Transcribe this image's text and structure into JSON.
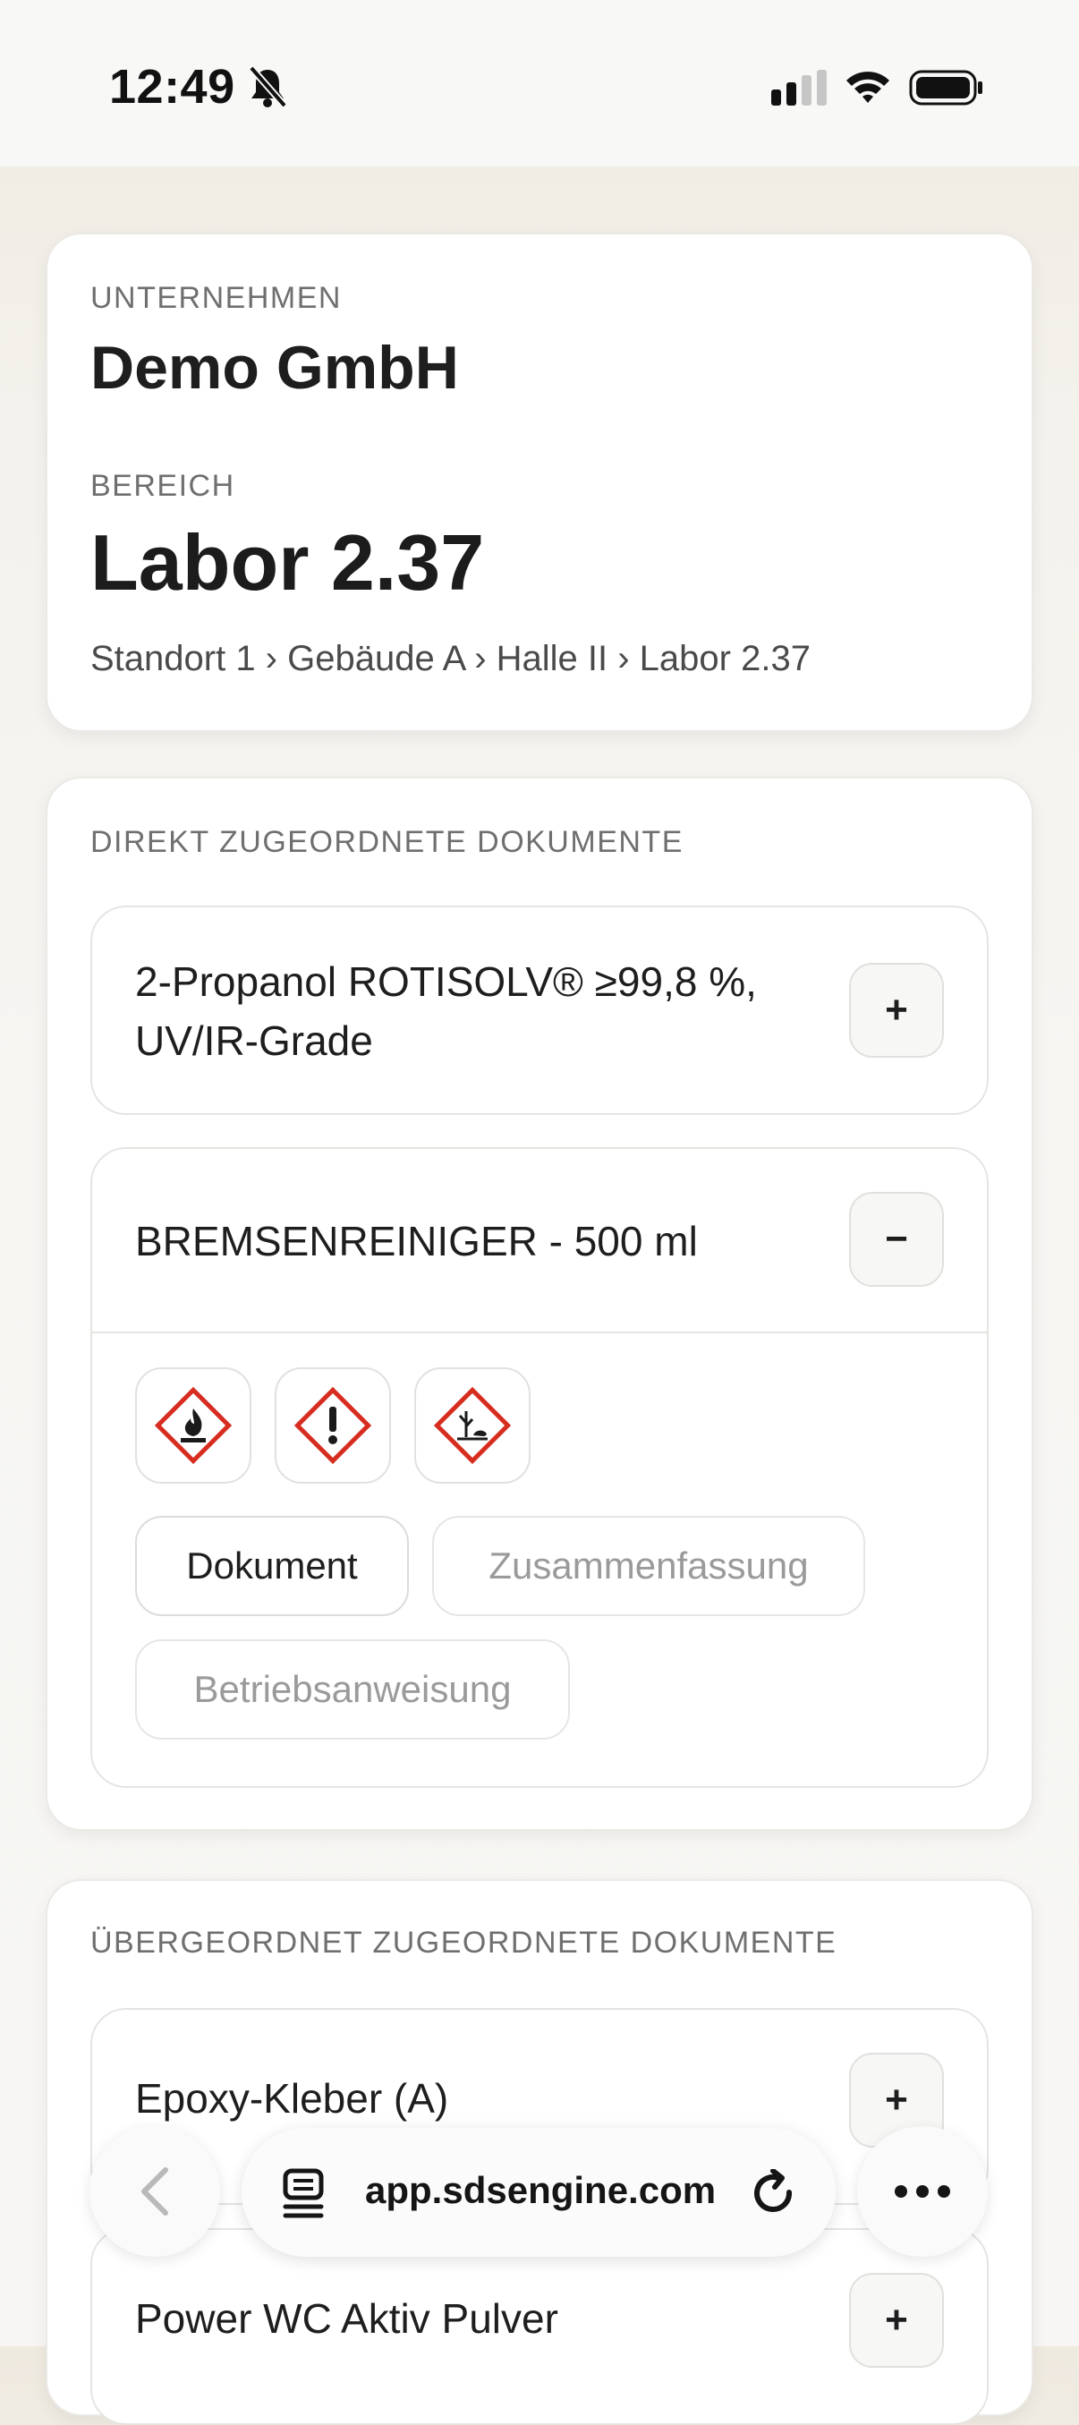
{
  "status_bar": {
    "time": "12:49"
  },
  "company_card": {
    "company_label": "UNTERNEHMEN",
    "company_name": "Demo GmbH",
    "area_label": "BEREICH",
    "area_name": "Labor 2.37",
    "breadcrumb": "Standort 1 › Gebäude A › Halle II › Labor 2.37"
  },
  "direct_docs": {
    "heading": "DIREKT ZUGEORDNETE DOKUMENTE",
    "items": [
      {
        "title": "2-Propanol ROTISOLV® ≥99,8 %, UV/IR-Grade",
        "toggle": "+"
      },
      {
        "title": "BREMSENREINIGER - 500 ml",
        "toggle": "−",
        "pictograms": [
          "flame-pictogram",
          "exclamation-pictogram",
          "environment-pictogram"
        ],
        "tabs": [
          "Dokument",
          "Zusammenfassung",
          "Betriebsanweisung"
        ],
        "active_tab": "Dokument"
      }
    ]
  },
  "parent_docs": {
    "heading": "ÜBERGEORDNET ZUGEORDNETE DOKUMENTE",
    "items": [
      {
        "title": "Epoxy-Kleber (A)",
        "toggle": "+"
      },
      {
        "title": "Power WC Aktiv Pulver",
        "toggle": "+"
      }
    ]
  },
  "browser": {
    "url": "app.sdsengine.com"
  },
  "colors": {
    "ghs_red": "#d62d20",
    "accent_text": "#1e1e1e",
    "muted_text": "#9a9a9a"
  }
}
